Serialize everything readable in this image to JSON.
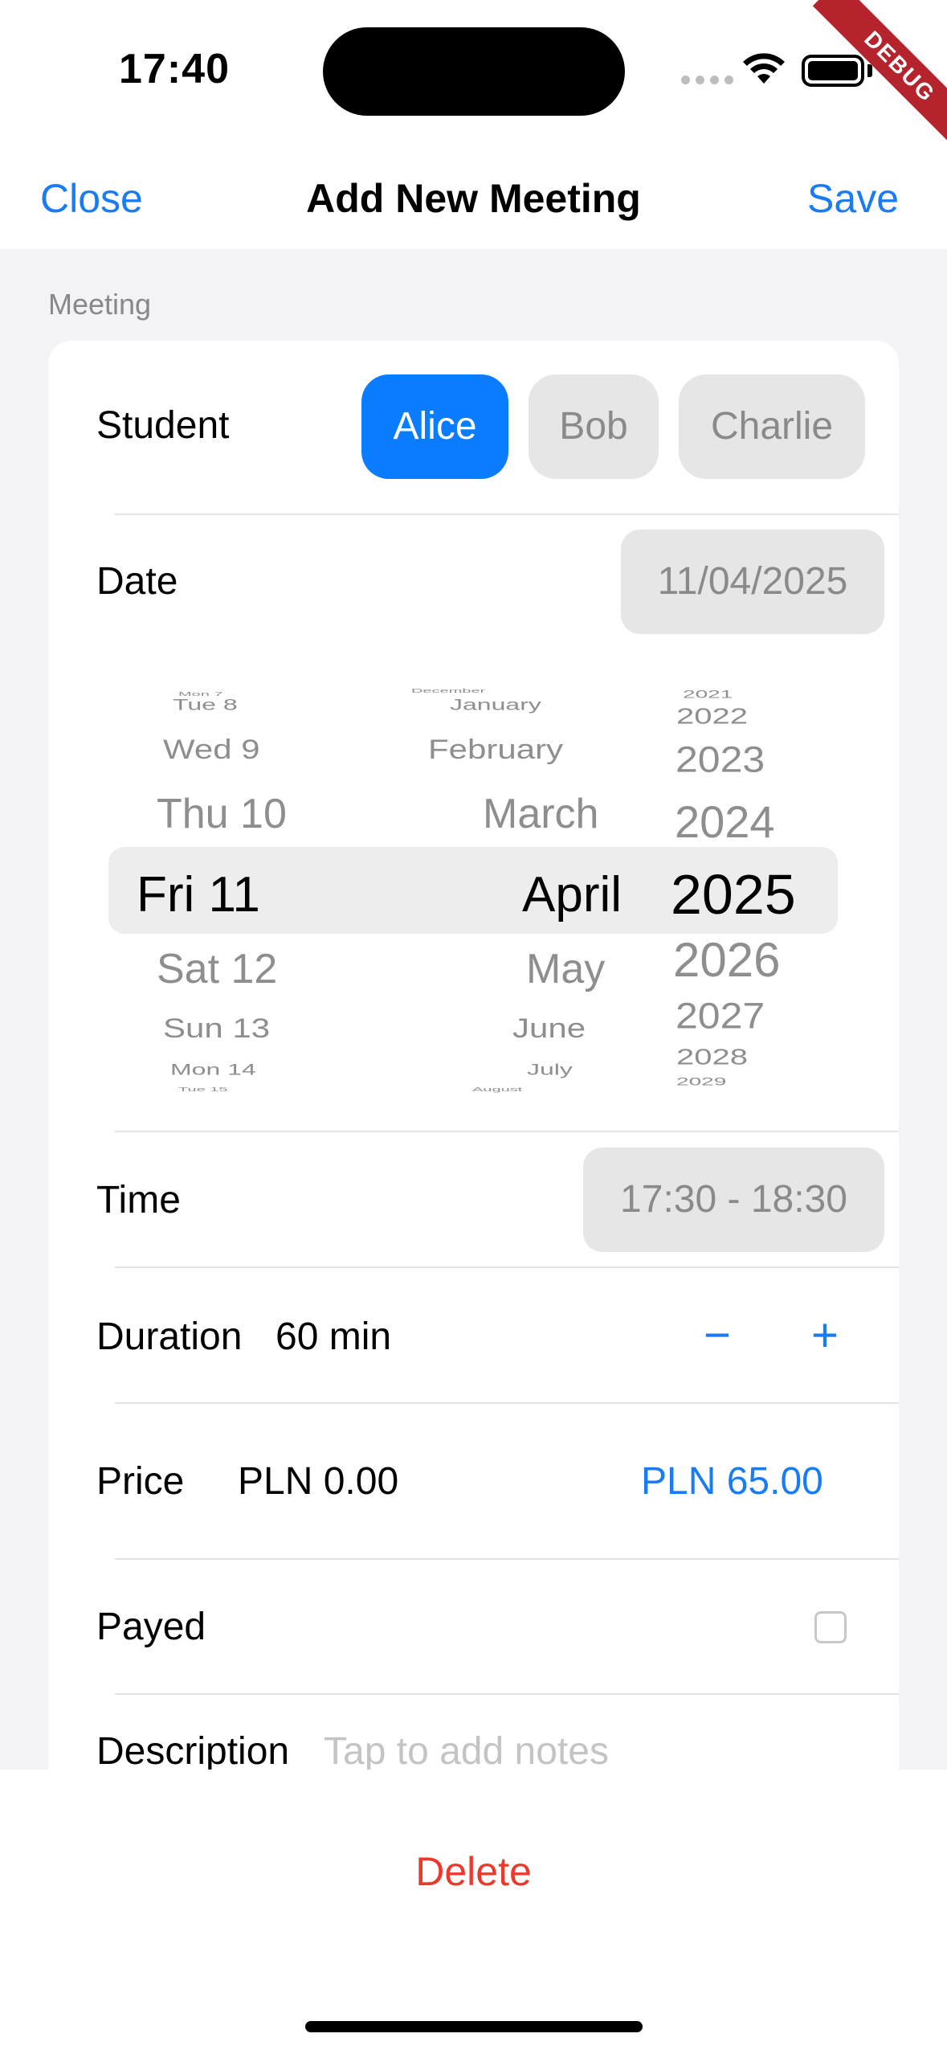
{
  "status_bar": {
    "time": "17:40",
    "debug_label": "DEBUG"
  },
  "nav": {
    "close_label": "Close",
    "title": "Add New Meeting",
    "save_label": "Save"
  },
  "section": {
    "header": "Meeting"
  },
  "student": {
    "label": "Student",
    "options": [
      "Alice",
      "Bob",
      "Charlie"
    ],
    "selected": "Alice"
  },
  "date": {
    "label": "Date",
    "value": "11/04/2025",
    "picker": {
      "days": [
        "Mon 7",
        "Tue 8",
        "Wed 9",
        "Thu 10",
        "Fri 11",
        "Sat 12",
        "Sun 13",
        "Mon 14",
        "Tue 15"
      ],
      "months": [
        "December",
        "January",
        "February",
        "March",
        "April",
        "May",
        "June",
        "July",
        "August"
      ],
      "years": [
        "2021",
        "2022",
        "2023",
        "2024",
        "2025",
        "2026",
        "2027",
        "2028",
        "2029"
      ],
      "selected_day": "Fri 11",
      "selected_month": "April",
      "selected_year": "2025"
    }
  },
  "time": {
    "label": "Time",
    "value": "17:30 - 18:30"
  },
  "duration": {
    "label": "Duration",
    "value": "60 min",
    "decrement_symbol": "−",
    "increment_symbol": "+"
  },
  "price": {
    "label": "Price",
    "value": "PLN 0.00",
    "suggested": "PLN 65.00"
  },
  "payed": {
    "label": "Payed",
    "checked": false
  },
  "description": {
    "label": "Description",
    "placeholder": "Tap to add notes"
  },
  "actions": {
    "delete_label": "Delete"
  },
  "colors": {
    "accent": "#1a7cf5",
    "selected_chip": "#0a7cff",
    "destructive": "#ea3a2d",
    "grouped_background": "#f2f2f7"
  }
}
